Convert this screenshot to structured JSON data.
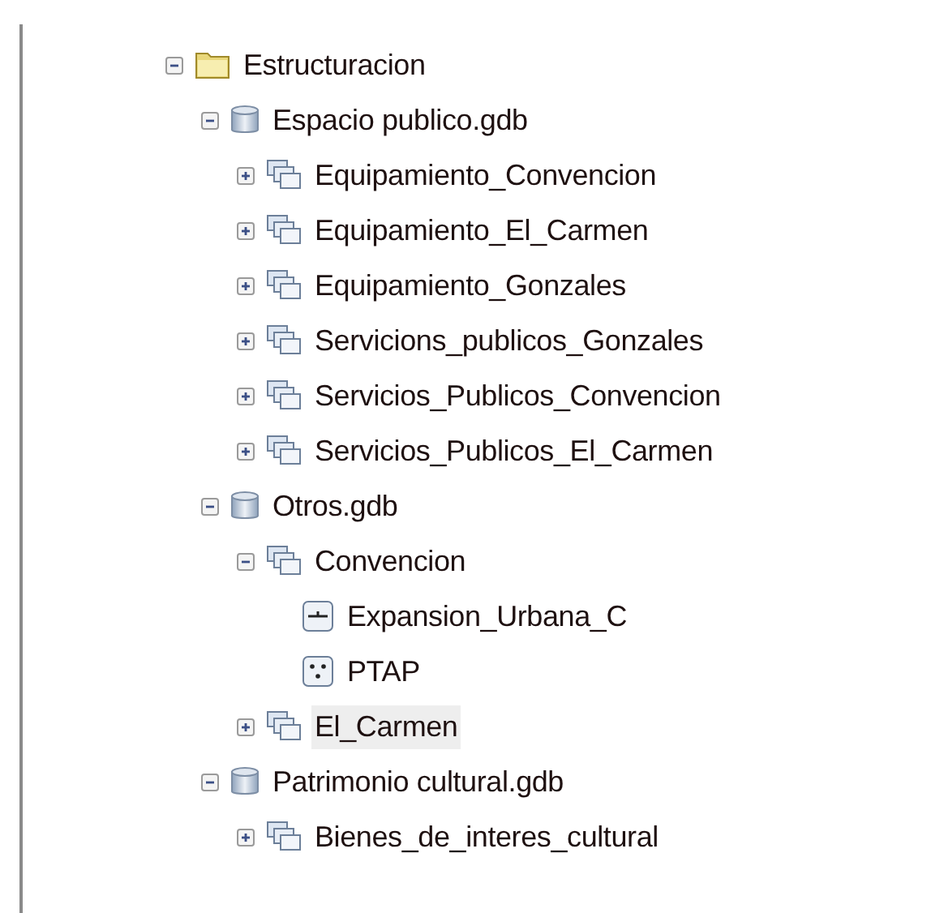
{
  "tree": [
    {
      "label": "Estructuracion",
      "kind": "folder",
      "expanded": true,
      "selected": false,
      "children": [
        {
          "label": "Espacio publico.gdb",
          "kind": "database",
          "expanded": true,
          "selected": false,
          "children": [
            {
              "label": "Equipamiento_Convencion",
              "kind": "dataset",
              "expanded": false,
              "selected": false
            },
            {
              "label": "Equipamiento_El_Carmen",
              "kind": "dataset",
              "expanded": false,
              "selected": false
            },
            {
              "label": "Equipamiento_Gonzales",
              "kind": "dataset",
              "expanded": false,
              "selected": false
            },
            {
              "label": "Servicions_publicos_Gonzales",
              "kind": "dataset",
              "expanded": false,
              "selected": false
            },
            {
              "label": "Servicios_Publicos_Convencion",
              "kind": "dataset",
              "expanded": false,
              "selected": false
            },
            {
              "label": "Servicios_Publicos_El_Carmen",
              "kind": "dataset",
              "expanded": false,
              "selected": false
            }
          ]
        },
        {
          "label": "Otros.gdb",
          "kind": "database",
          "expanded": true,
          "selected": false,
          "children": [
            {
              "label": "Convencion",
              "kind": "dataset",
              "expanded": true,
              "selected": false,
              "children": [
                {
                  "label": "Expansion_Urbana_C",
                  "kind": "line",
                  "selected": false
                },
                {
                  "label": "PTAP",
                  "kind": "point",
                  "selected": false
                }
              ]
            },
            {
              "label": "El_Carmen",
              "kind": "dataset",
              "expanded": false,
              "selected": true
            }
          ]
        },
        {
          "label": "Patrimonio cultural.gdb",
          "kind": "database",
          "expanded": true,
          "selected": false,
          "children": [
            {
              "label": "Bienes_de_interes_cultural",
              "kind": "dataset",
              "expanded": false,
              "selected": false
            }
          ]
        }
      ]
    }
  ]
}
